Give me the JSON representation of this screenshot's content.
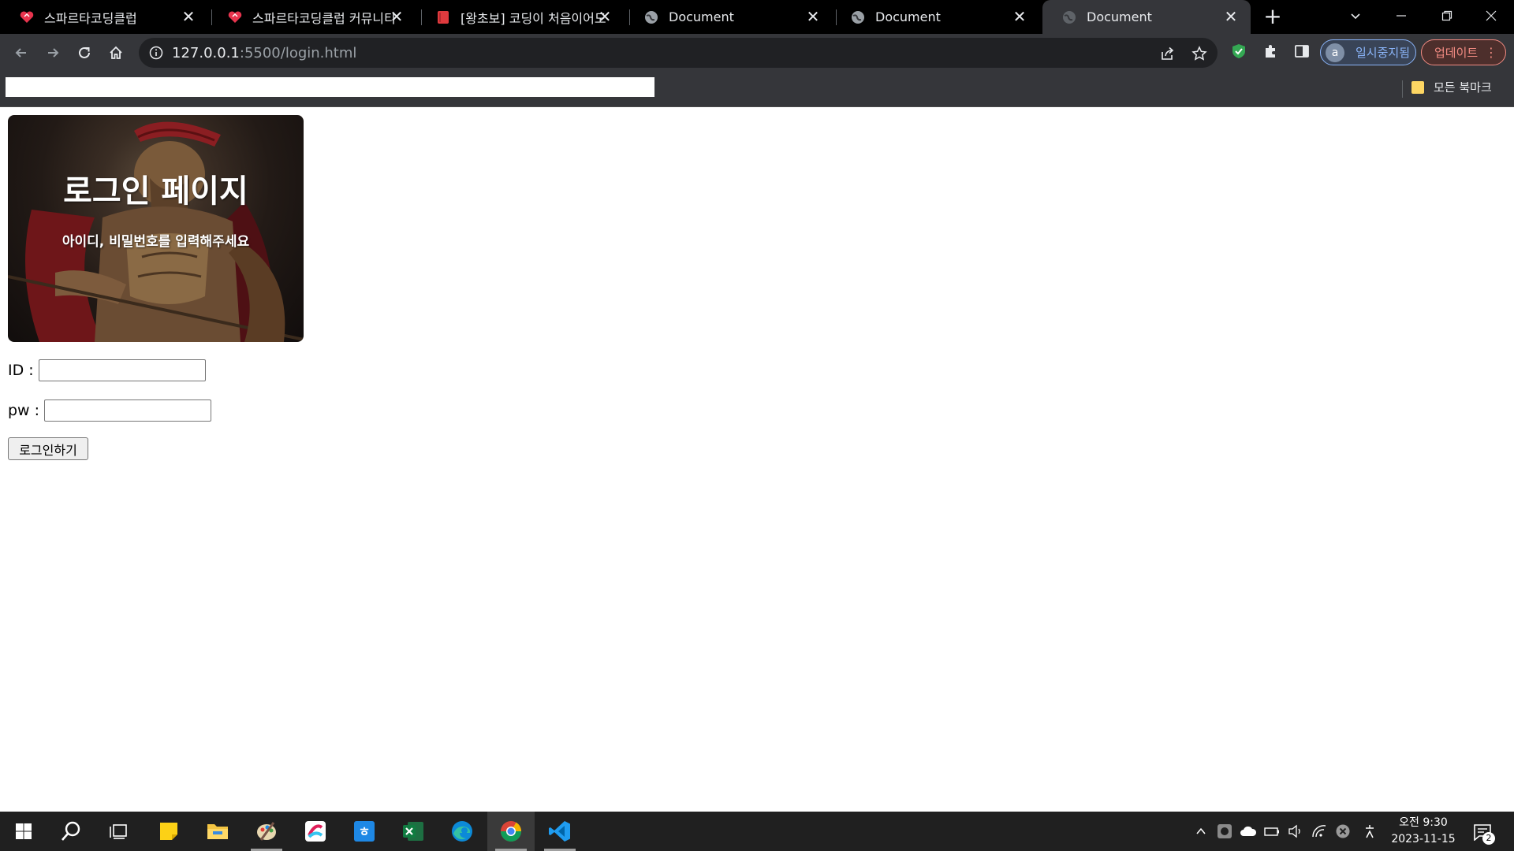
{
  "tabs": [
    {
      "title": "스파르타코딩클럽",
      "icon": "spartan-heart-icon"
    },
    {
      "title": "스파르타코딩클럽 커뮤니티",
      "icon": "spartan-heart-icon"
    },
    {
      "title": "[왕초보] 코딩이 처음이어도",
      "icon": "red-book-icon"
    },
    {
      "title": "Document",
      "icon": "globe-icon"
    },
    {
      "title": "Document",
      "icon": "globe-icon"
    },
    {
      "title": "Document",
      "icon": "globe-icon",
      "active": true
    }
  ],
  "address": {
    "host": "127.0.0.1",
    "path": ":5500/login.html"
  },
  "profile": {
    "initial": "a",
    "label": "일시중지됨"
  },
  "update_label": "업데이트",
  "bookmarks": {
    "all_label": "모든 북마크"
  },
  "hero": {
    "title": "로그인 페이지",
    "subtitle": "아이디, 비밀번호를 입력해주세요"
  },
  "form": {
    "id_label": "ID :",
    "pw_label": "pw :",
    "id_value": "",
    "pw_value": "",
    "submit_label": "로그인하기"
  },
  "taskbar": {
    "apps": [
      "windows-start-icon",
      "search-icon",
      "task-view-icon",
      "sticky-notes-icon",
      "file-explorer-icon",
      "paint-icon",
      "slack-icon",
      "hangul-icon",
      "excel-icon",
      "edge-icon",
      "chrome-icon",
      "vscode-icon"
    ],
    "clock_time": "오전 9:30",
    "clock_date": "2023-11-15",
    "notification_count": "2"
  },
  "colors": {
    "accent_blue": "#8ab4f8",
    "update_red": "#f28b82",
    "folder_yellow": "#fdd663"
  }
}
